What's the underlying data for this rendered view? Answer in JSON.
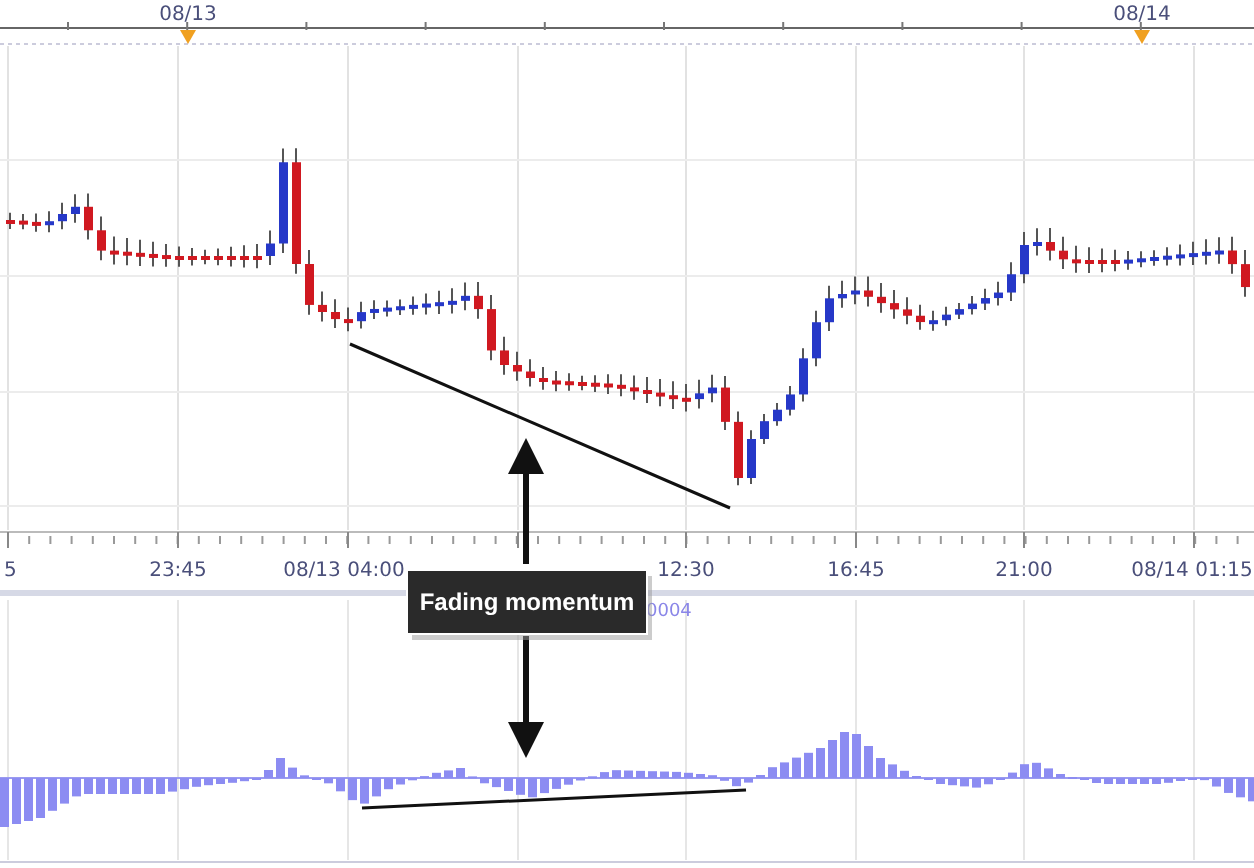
{
  "date_strip": {
    "labels": [
      {
        "text": "08/13"
      },
      {
        "text": "08/14"
      }
    ]
  },
  "time_axis": {
    "labels": [
      {
        "text": "5"
      },
      {
        "text": "23:45"
      },
      {
        "text": "08/13 04:00"
      },
      {
        "text": "12:30"
      },
      {
        "text": "16:45"
      },
      {
        "text": "21:00"
      },
      {
        "text": "08/14 01:15"
      }
    ]
  },
  "indicator": {
    "label": "0004"
  },
  "callout": {
    "text": "Fading momentum"
  }
}
